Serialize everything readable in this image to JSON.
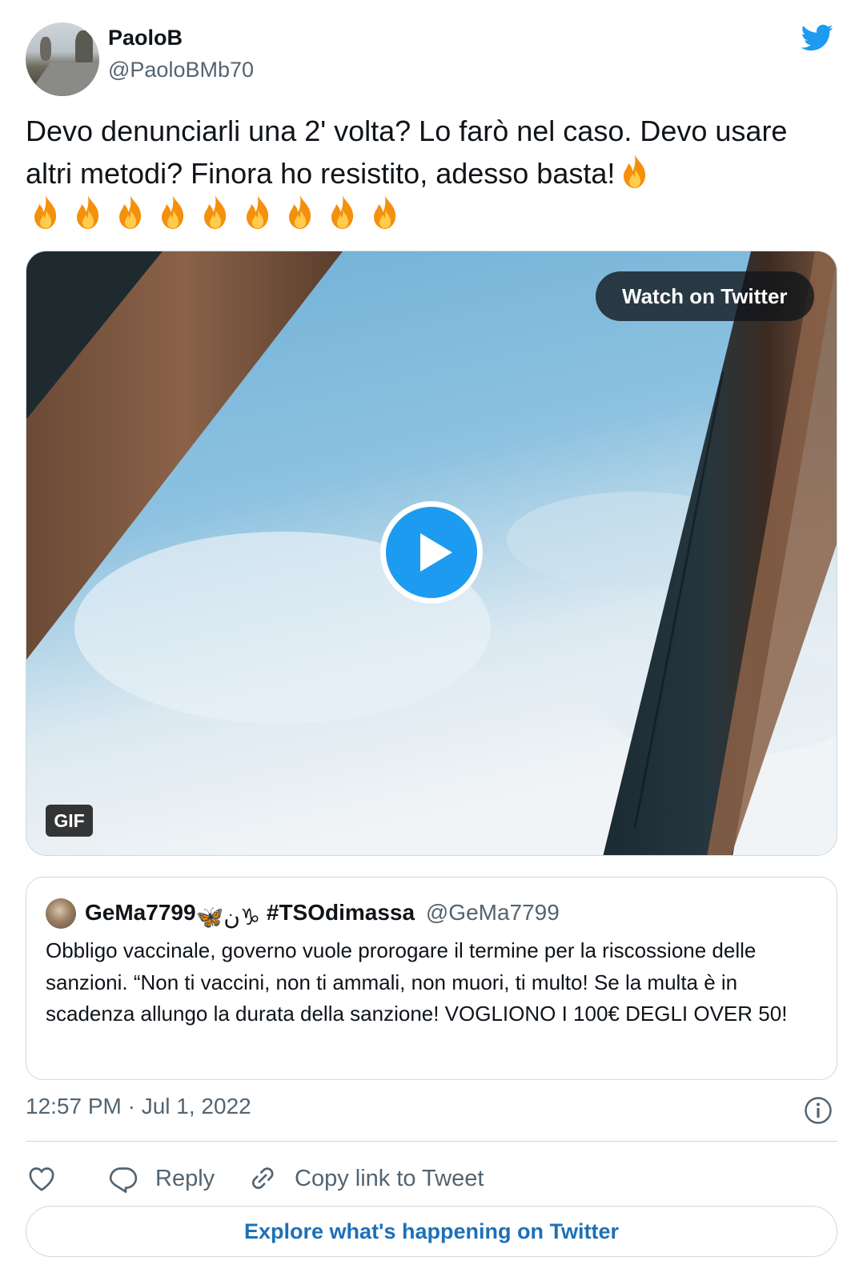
{
  "author": {
    "name": "PaoloB",
    "handle": "@PaoloBMb70",
    "avatar_icon": "profile-photo-road"
  },
  "tweet": {
    "text_line": "Devo denunciarli una 2' volta? Lo farò nel caso. Devo usare altri metodi? Finora ho resistito,  adesso basta!",
    "flame_emoji": "🔥",
    "flame_count_trailing": 9
  },
  "media": {
    "watch_label": "Watch on Twitter",
    "gif_label": "GIF",
    "play_icon": "play-icon"
  },
  "quoted": {
    "name": "GeMa7799",
    "name_emojis": "🦋ن♑",
    "hashtag": "#TSOdimassa",
    "handle": "@GeMa7799",
    "text": "Obbligo vaccinale, governo vuole prorogare il termine per la riscossione delle sanzioni. “Non ti vaccini, non ti ammali, non muori, ti multo! Se la multa è in scadenza allungo la durata della sanzione! VOGLIONO I 100€ DEGLI OVER 50!"
  },
  "footer": {
    "timestamp": "12:57 PM · Jul 1, 2022",
    "reply_label": "Reply",
    "copy_link_label": "Copy link to Tweet",
    "explore_label": "Explore what's happening on Twitter"
  },
  "colors": {
    "twitter_blue": "#1d9bf0",
    "explore_link": "#1d70b8",
    "secondary_text": "#536471",
    "border": "#cfd9de"
  }
}
